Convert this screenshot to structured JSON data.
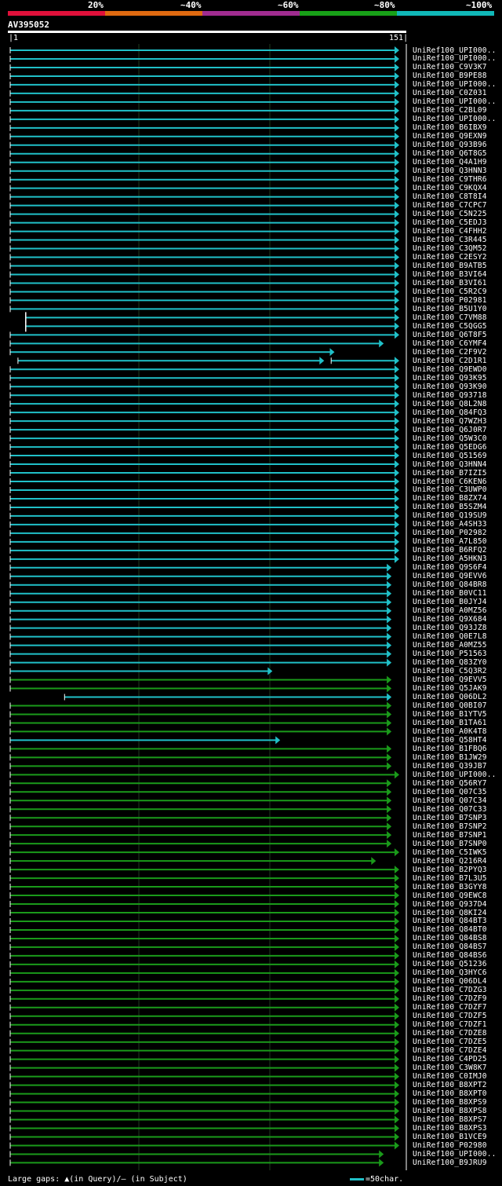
{
  "header": {
    "scale_labels": [
      "20%",
      "~40%",
      "~60%",
      "~80%",
      "~100%"
    ],
    "scale_colors": [
      "#e0103a",
      "#e06a10",
      "#a02c90",
      "#18a018",
      "#10b8b8"
    ],
    "query_name": "AV395052",
    "ruler_start": "1",
    "ruler_end": "151"
  },
  "footer": {
    "large_gaps": "Large gaps: ▲(in Query)/– (in Subject)",
    "legend_text": "=50char."
  },
  "colors": {
    "cyan": "#20c0c8",
    "green": "#1a9a1a",
    "divider": "#ffffff"
  },
  "hits": [
    {
      "name": "UniRef100_UPI000..",
      "c": "cyan",
      "s": 1,
      "e": 151,
      "s2": null
    },
    {
      "name": "UniRef100_UPI000..",
      "c": "cyan",
      "s": 1,
      "e": 151
    },
    {
      "name": "UniRef100_C9V3K7",
      "c": "cyan",
      "s": 1,
      "e": 151
    },
    {
      "name": "UniRef100_B9PE88",
      "c": "cyan",
      "s": 1,
      "e": 151
    },
    {
      "name": "UniRef100_UPI000..",
      "c": "cyan",
      "s": 1,
      "e": 151
    },
    {
      "name": "UniRef100_C0Z031",
      "c": "cyan",
      "s": 1,
      "e": 151
    },
    {
      "name": "UniRef100_UPI000..",
      "c": "cyan",
      "s": 1,
      "e": 151
    },
    {
      "name": "UniRef100_C2BL09",
      "c": "cyan",
      "s": 1,
      "e": 151
    },
    {
      "name": "UniRef100_UPI000..",
      "c": "cyan",
      "s": 1,
      "e": 151
    },
    {
      "name": "UniRef100_B6IBX9",
      "c": "cyan",
      "s": 1,
      "e": 151
    },
    {
      "name": "UniRef100_Q9EXN9",
      "c": "cyan",
      "s": 1,
      "e": 151
    },
    {
      "name": "UniRef100_Q93B96",
      "c": "cyan",
      "s": 1,
      "e": 151
    },
    {
      "name": "UniRef100_Q6T8G5",
      "c": "cyan",
      "s": 1,
      "e": 151
    },
    {
      "name": "UniRef100_Q4A1H9",
      "c": "cyan",
      "s": 1,
      "e": 151
    },
    {
      "name": "UniRef100_Q3HNN3",
      "c": "cyan",
      "s": 1,
      "e": 151
    },
    {
      "name": "UniRef100_C9THR6",
      "c": "cyan",
      "s": 1,
      "e": 151
    },
    {
      "name": "UniRef100_C9KQX4",
      "c": "cyan",
      "s": 1,
      "e": 151
    },
    {
      "name": "UniRef100_C8T8I4",
      "c": "cyan",
      "s": 1,
      "e": 151
    },
    {
      "name": "UniRef100_C7CPC7",
      "c": "cyan",
      "s": 1,
      "e": 151
    },
    {
      "name": "UniRef100_C5N225",
      "c": "cyan",
      "s": 1,
      "e": 151
    },
    {
      "name": "UniRef100_C5EDJ3",
      "c": "cyan",
      "s": 1,
      "e": 151
    },
    {
      "name": "UniRef100_C4FHH2",
      "c": "cyan",
      "s": 1,
      "e": 151
    },
    {
      "name": "UniRef100_C3R445",
      "c": "cyan",
      "s": 1,
      "e": 151
    },
    {
      "name": "UniRef100_C3QM52",
      "c": "cyan",
      "s": 1,
      "e": 151
    },
    {
      "name": "UniRef100_C2ESY2",
      "c": "cyan",
      "s": 1,
      "e": 151
    },
    {
      "name": "UniRef100_B9ATB5",
      "c": "cyan",
      "s": 1,
      "e": 151
    },
    {
      "name": "UniRef100_B3VI64",
      "c": "cyan",
      "s": 1,
      "e": 151
    },
    {
      "name": "UniRef100_B3VI61",
      "c": "cyan",
      "s": 1,
      "e": 151
    },
    {
      "name": "UniRef100_C5R2C9",
      "c": "cyan",
      "s": 1,
      "e": 151
    },
    {
      "name": "UniRef100_P02981",
      "c": "cyan",
      "s": 1,
      "e": 151
    },
    {
      "name": "UniRef100_B5U1Y0",
      "c": "cyan",
      "s": 1,
      "e": 151
    },
    {
      "name": "UniRef100_C7VM88",
      "c": "cyan",
      "s": 7,
      "e": 151,
      "mark": true
    },
    {
      "name": "UniRef100_C5QGG5",
      "c": "cyan",
      "s": 7,
      "e": 151,
      "mark": true
    },
    {
      "name": "UniRef100_Q6T8F5",
      "c": "cyan",
      "s": 1,
      "e": 151
    },
    {
      "name": "UniRef100_C6YMF4",
      "c": "cyan",
      "s": 1,
      "e": 145
    },
    {
      "name": "UniRef100_C2F9V2",
      "c": "cyan",
      "s": 1,
      "e": 126
    },
    {
      "name": "UniRef100_C2D1R1",
      "c": "cyan",
      "s": 4,
      "e": 122,
      "s2": 125,
      "e2": 151
    },
    {
      "name": "UniRef100_Q9EWD0",
      "c": "cyan",
      "s": 1,
      "e": 151
    },
    {
      "name": "UniRef100_Q93K95",
      "c": "cyan",
      "s": 1,
      "e": 151
    },
    {
      "name": "UniRef100_Q93K90",
      "c": "cyan",
      "s": 1,
      "e": 151
    },
    {
      "name": "UniRef100_Q93718",
      "c": "cyan",
      "s": 1,
      "e": 151
    },
    {
      "name": "UniRef100_Q8L2N8",
      "c": "cyan",
      "s": 1,
      "e": 151
    },
    {
      "name": "UniRef100_Q84FQ3",
      "c": "cyan",
      "s": 1,
      "e": 151
    },
    {
      "name": "UniRef100_Q7WZH3",
      "c": "cyan",
      "s": 1,
      "e": 151
    },
    {
      "name": "UniRef100_Q6J0R7",
      "c": "cyan",
      "s": 1,
      "e": 151
    },
    {
      "name": "UniRef100_Q5W3C0",
      "c": "cyan",
      "s": 1,
      "e": 151
    },
    {
      "name": "UniRef100_Q5EDG6",
      "c": "cyan",
      "s": 1,
      "e": 151
    },
    {
      "name": "UniRef100_Q51569",
      "c": "cyan",
      "s": 1,
      "e": 151
    },
    {
      "name": "UniRef100_Q3HNN4",
      "c": "cyan",
      "s": 1,
      "e": 151
    },
    {
      "name": "UniRef100_B7IZI5",
      "c": "cyan",
      "s": 1,
      "e": 151
    },
    {
      "name": "UniRef100_C6KEN6",
      "c": "cyan",
      "s": 1,
      "e": 151
    },
    {
      "name": "UniRef100_C3UWP0",
      "c": "cyan",
      "s": 1,
      "e": 151
    },
    {
      "name": "UniRef100_B8ZX74",
      "c": "cyan",
      "s": 1,
      "e": 151
    },
    {
      "name": "UniRef100_B5SZM4",
      "c": "cyan",
      "s": 1,
      "e": 151
    },
    {
      "name": "UniRef100_Q19SU9",
      "c": "cyan",
      "s": 1,
      "e": 151
    },
    {
      "name": "UniRef100_A4SH33",
      "c": "cyan",
      "s": 1,
      "e": 151
    },
    {
      "name": "UniRef100_P02982",
      "c": "cyan",
      "s": 1,
      "e": 151
    },
    {
      "name": "UniRef100_A7L850",
      "c": "cyan",
      "s": 1,
      "e": 151
    },
    {
      "name": "UniRef100_B6RFQ2",
      "c": "cyan",
      "s": 1,
      "e": 151
    },
    {
      "name": "UniRef100_A5HKN3",
      "c": "cyan",
      "s": 1,
      "e": 151
    },
    {
      "name": "UniRef100_Q9S6F4",
      "c": "cyan",
      "s": 1,
      "e": 148
    },
    {
      "name": "UniRef100_Q9EVV6",
      "c": "cyan",
      "s": 1,
      "e": 148
    },
    {
      "name": "UniRef100_Q84BR8",
      "c": "cyan",
      "s": 1,
      "e": 148
    },
    {
      "name": "UniRef100_B0VC11",
      "c": "cyan",
      "s": 1,
      "e": 148
    },
    {
      "name": "UniRef100_B0JYJ4",
      "c": "cyan",
      "s": 1,
      "e": 148
    },
    {
      "name": "UniRef100_A0MZ56",
      "c": "cyan",
      "s": 1,
      "e": 148
    },
    {
      "name": "UniRef100_Q9X684",
      "c": "cyan",
      "s": 1,
      "e": 148
    },
    {
      "name": "UniRef100_Q93JZ8",
      "c": "cyan",
      "s": 1,
      "e": 148
    },
    {
      "name": "UniRef100_Q0E7L8",
      "c": "cyan",
      "s": 1,
      "e": 148
    },
    {
      "name": "UniRef100_A0MZ55",
      "c": "cyan",
      "s": 1,
      "e": 148
    },
    {
      "name": "UniRef100_P51563",
      "c": "cyan",
      "s": 1,
      "e": 148
    },
    {
      "name": "UniRef100_Q83ZY0",
      "c": "cyan",
      "s": 1,
      "e": 148
    },
    {
      "name": "UniRef100_C5Q3R2",
      "c": "cyan",
      "s": 1,
      "e": 102
    },
    {
      "name": "UniRef100_Q9EVV5",
      "c": "green",
      "s": 1,
      "e": 148
    },
    {
      "name": "UniRef100_Q5JAK9",
      "c": "green",
      "s": 1,
      "e": 148
    },
    {
      "name": "UniRef100_Q06DL2",
      "c": "cyan",
      "s": 22,
      "e": 148
    },
    {
      "name": "UniRef100_Q0BI07",
      "c": "green",
      "s": 1,
      "e": 148
    },
    {
      "name": "UniRef100_B1YTV5",
      "c": "green",
      "s": 1,
      "e": 148
    },
    {
      "name": "UniRef100_B1TA61",
      "c": "green",
      "s": 1,
      "e": 148
    },
    {
      "name": "UniRef100_A0K4T8",
      "c": "green",
      "s": 1,
      "e": 148
    },
    {
      "name": "UniRef100_Q58HT4",
      "c": "cyan",
      "s": 1,
      "e": 105
    },
    {
      "name": "UniRef100_B1FBQ6",
      "c": "green",
      "s": 1,
      "e": 148
    },
    {
      "name": "UniRef100_B1JW29",
      "c": "green",
      "s": 1,
      "e": 148
    },
    {
      "name": "UniRef100_Q39JB7",
      "c": "green",
      "s": 1,
      "e": 148
    },
    {
      "name": "UniRef100_UPI000..",
      "c": "green",
      "s": 1,
      "e": 151
    },
    {
      "name": "UniRef100_Q56RY7",
      "c": "green",
      "s": 1,
      "e": 148
    },
    {
      "name": "UniRef100_Q07C35",
      "c": "green",
      "s": 1,
      "e": 148
    },
    {
      "name": "UniRef100_Q07C34",
      "c": "green",
      "s": 1,
      "e": 148
    },
    {
      "name": "UniRef100_Q07C33",
      "c": "green",
      "s": 1,
      "e": 148
    },
    {
      "name": "UniRef100_B7SNP3",
      "c": "green",
      "s": 1,
      "e": 148
    },
    {
      "name": "UniRef100_B7SNP2",
      "c": "green",
      "s": 1,
      "e": 148
    },
    {
      "name": "UniRef100_B7SNP1",
      "c": "green",
      "s": 1,
      "e": 148
    },
    {
      "name": "UniRef100_B7SNP0",
      "c": "green",
      "s": 1,
      "e": 148
    },
    {
      "name": "UniRef100_C5IWK5",
      "c": "green",
      "s": 1,
      "e": 151
    },
    {
      "name": "UniRef100_Q216R4",
      "c": "green",
      "s": 1,
      "e": 142
    },
    {
      "name": "UniRef100_B2PYQ3",
      "c": "green",
      "s": 1,
      "e": 151
    },
    {
      "name": "UniRef100_B7L3U5",
      "c": "green",
      "s": 1,
      "e": 151
    },
    {
      "name": "UniRef100_B3GYY8",
      "c": "green",
      "s": 1,
      "e": 151
    },
    {
      "name": "UniRef100_Q9EWC8",
      "c": "green",
      "s": 1,
      "e": 151
    },
    {
      "name": "UniRef100_Q937D4",
      "c": "green",
      "s": 1,
      "e": 151
    },
    {
      "name": "UniRef100_Q8KI24",
      "c": "green",
      "s": 1,
      "e": 151
    },
    {
      "name": "UniRef100_Q84BT3",
      "c": "green",
      "s": 1,
      "e": 151
    },
    {
      "name": "UniRef100_Q84BT0",
      "c": "green",
      "s": 1,
      "e": 151
    },
    {
      "name": "UniRef100_Q84BS8",
      "c": "green",
      "s": 1,
      "e": 151
    },
    {
      "name": "UniRef100_Q84BS7",
      "c": "green",
      "s": 1,
      "e": 151
    },
    {
      "name": "UniRef100_Q84BS6",
      "c": "green",
      "s": 1,
      "e": 151
    },
    {
      "name": "UniRef100_Q51236",
      "c": "green",
      "s": 1,
      "e": 151
    },
    {
      "name": "UniRef100_Q3HYC6",
      "c": "green",
      "s": 1,
      "e": 151
    },
    {
      "name": "UniRef100_Q06DL4",
      "c": "green",
      "s": 1,
      "e": 151
    },
    {
      "name": "UniRef100_C7DZG3",
      "c": "green",
      "s": 1,
      "e": 151
    },
    {
      "name": "UniRef100_C7DZF9",
      "c": "green",
      "s": 1,
      "e": 151
    },
    {
      "name": "UniRef100_C7DZF7",
      "c": "green",
      "s": 1,
      "e": 151
    },
    {
      "name": "UniRef100_C7DZF5",
      "c": "green",
      "s": 1,
      "e": 151
    },
    {
      "name": "UniRef100_C7DZF1",
      "c": "green",
      "s": 1,
      "e": 151
    },
    {
      "name": "UniRef100_C7DZE8",
      "c": "green",
      "s": 1,
      "e": 151
    },
    {
      "name": "UniRef100_C7DZE5",
      "c": "green",
      "s": 1,
      "e": 151
    },
    {
      "name": "UniRef100_C7DZE4",
      "c": "green",
      "s": 1,
      "e": 151
    },
    {
      "name": "UniRef100_C4PD25",
      "c": "green",
      "s": 1,
      "e": 151
    },
    {
      "name": "UniRef100_C3W8K7",
      "c": "green",
      "s": 1,
      "e": 151
    },
    {
      "name": "UniRef100_C0IMJ0",
      "c": "green",
      "s": 1,
      "e": 151
    },
    {
      "name": "UniRef100_B8XPT2",
      "c": "green",
      "s": 1,
      "e": 151
    },
    {
      "name": "UniRef100_B8XPT0",
      "c": "green",
      "s": 1,
      "e": 151
    },
    {
      "name": "UniRef100_B8XPS9",
      "c": "green",
      "s": 1,
      "e": 151
    },
    {
      "name": "UniRef100_B8XPS8",
      "c": "green",
      "s": 1,
      "e": 151
    },
    {
      "name": "UniRef100_B8XPS7",
      "c": "green",
      "s": 1,
      "e": 151
    },
    {
      "name": "UniRef100_B8XPS3",
      "c": "green",
      "s": 1,
      "e": 151
    },
    {
      "name": "UniRef100_B1VCE9",
      "c": "green",
      "s": 1,
      "e": 151
    },
    {
      "name": "UniRef100_P02980",
      "c": "green",
      "s": 1,
      "e": 151
    },
    {
      "name": "UniRef100_UPI000..",
      "c": "green",
      "s": 1,
      "e": 145
    },
    {
      "name": "UniRef100_B9JRU9",
      "c": "green",
      "s": 1,
      "e": 145
    }
  ]
}
